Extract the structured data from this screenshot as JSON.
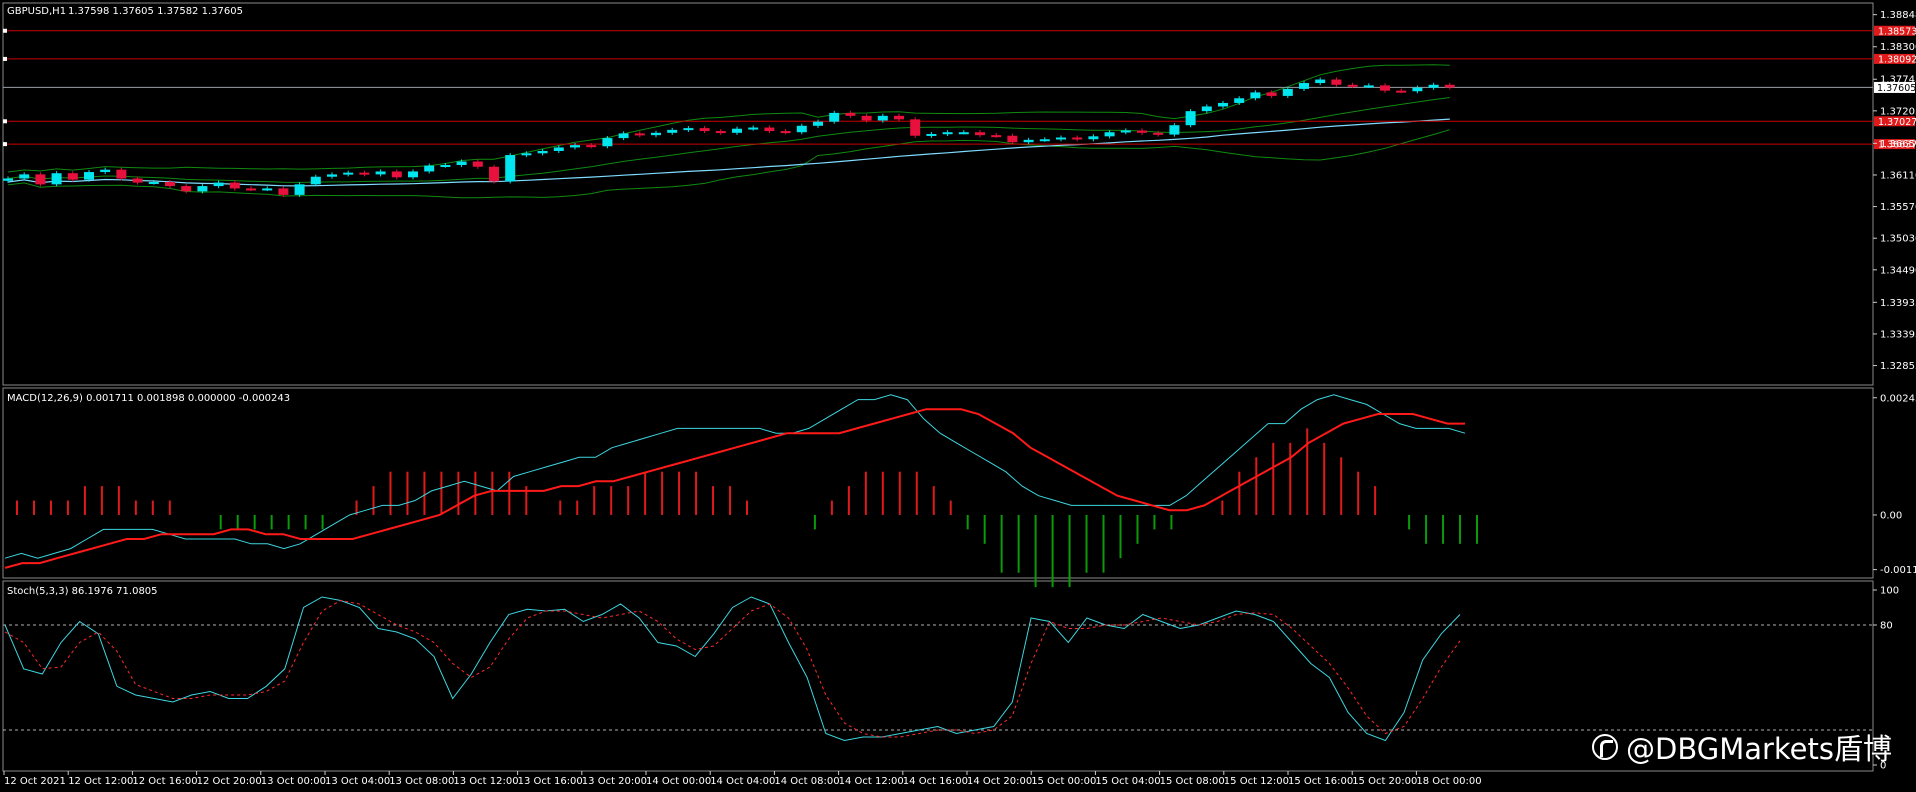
{
  "main_header": {
    "symbol": "GBPUSD,H1",
    "ohlc": "1.37598 1.37605 1.37582 1.37605"
  },
  "macd_header": "MACD(12,26,9) 0.001711 0.001898 0.000000 -0.000243",
  "stoch_header": "Stoch(5,3,3) 86.1976 71.0805",
  "watermark": "@DBGMarkets盾博",
  "colors": {
    "bull": "#00e5ee",
    "bear": "#e8103c",
    "bands": "#0f8a0f",
    "ma": "#7fdcff",
    "hline": "#c80000",
    "macd_line": "#3dd6e0",
    "signal_line": "#ff1a1a",
    "hist_pos": "#e01a1a",
    "hist_neg": "#0a9a0a",
    "stoch_main": "#3dd6e0",
    "stoch_signal": "#ff2a2a"
  },
  "chart_data": [
    {
      "type": "candlestick",
      "title": "GBPUSD,H1",
      "ylim": [
        1.3254,
        1.3903
      ],
      "y_ticks": [
        "1.38848",
        "1.38300",
        "1.37745",
        "1.37205",
        "1.36650",
        "1.36110",
        "1.35570",
        "1.35030",
        "1.34490",
        "1.33935",
        "1.33395",
        "1.32855"
      ],
      "y_tick_values": [
        1.38848,
        1.383,
        1.37745,
        1.37205,
        1.3665,
        1.3611,
        1.3557,
        1.3503,
        1.3449,
        1.33935,
        1.33395,
        1.32855
      ],
      "current_price": {
        "label": "1.37605",
        "value": 1.37605
      },
      "horizontal_levels": [
        {
          "label": "1.38573",
          "value": 1.38573
        },
        {
          "label": "1.38092",
          "value": 1.38092
        },
        {
          "label": "1.37027",
          "value": 1.37027
        },
        {
          "label": "1.36637",
          "value": 1.36637
        }
      ],
      "x_labels": [
        "12 Oct 2021",
        "12 Oct 12:00",
        "12 Oct 16:00",
        "12 Oct 20:00",
        "13 Oct 00:00",
        "13 Oct 04:00",
        "13 Oct 08:00",
        "13 Oct 12:00",
        "13 Oct 16:00",
        "13 Oct 20:00",
        "14 Oct 00:00",
        "14 Oct 04:00",
        "14 Oct 08:00",
        "14 Oct 12:00",
        "14 Oct 16:00",
        "14 Oct 20:00",
        "15 Oct 00:00",
        "15 Oct 04:00",
        "15 Oct 08:00",
        "15 Oct 12:00",
        "15 Oct 16:00",
        "15 Oct 20:00",
        "18 Oct 00:00"
      ],
      "closes": [
        1.3605,
        1.3612,
        1.3595,
        1.3614,
        1.3603,
        1.3616,
        1.362,
        1.3605,
        1.3598,
        1.3599,
        1.3592,
        1.3583,
        1.3592,
        1.3598,
        1.3588,
        1.3587,
        1.3588,
        1.3577,
        1.3595,
        1.3608,
        1.3612,
        1.3615,
        1.3612,
        1.3617,
        1.3607,
        1.3617,
        1.3627,
        1.3628,
        1.3634,
        1.3625,
        1.36,
        1.3645,
        1.3648,
        1.3652,
        1.3658,
        1.3662,
        1.366,
        1.3674,
        1.3682,
        1.3679,
        1.3683,
        1.3688,
        1.3691,
        1.3686,
        1.3683,
        1.369,
        1.3692,
        1.3686,
        1.3684,
        1.3695,
        1.3702,
        1.3717,
        1.3712,
        1.3704,
        1.3712,
        1.3706,
        1.3678,
        1.3681,
        1.3684,
        1.3684,
        1.3679,
        1.3678,
        1.3667,
        1.3671,
        1.3672,
        1.3675,
        1.3672,
        1.3677,
        1.3684,
        1.3687,
        1.3683,
        1.368,
        1.3696,
        1.372,
        1.3728,
        1.3734,
        1.3742,
        1.3752,
        1.3746,
        1.3758,
        1.3768,
        1.3774,
        1.3765,
        1.3763,
        1.3764,
        1.3755,
        1.3754,
        1.376,
        1.3765,
        1.37605
      ]
    },
    {
      "type": "line",
      "title": "MACD(12,26,9)",
      "y_ticks": [
        "0.002438",
        "0.00",
        "-0.001136"
      ],
      "ylim": [
        -0.00129,
        0.00262
      ],
      "main": 0.001711,
      "signal": 0.001898,
      "histogram_note": "OsMA bars: positive red, negative green",
      "macd_values": [
        -0.0009,
        -0.0008,
        -0.0009,
        -0.0008,
        -0.0007,
        -0.0005,
        -0.0003,
        -0.0003,
        -0.0003,
        -0.0003,
        -0.0004,
        -0.0005,
        -0.0005,
        -0.0005,
        -0.0005,
        -0.0006,
        -0.0006,
        -0.0007,
        -0.0006,
        -0.0004,
        -0.0002,
        0.0,
        0.0001,
        0.0002,
        0.0002,
        0.0003,
        0.0005,
        0.0006,
        0.0007,
        0.0006,
        0.0005,
        0.0008,
        0.0009,
        0.001,
        0.0011,
        0.0012,
        0.0012,
        0.0014,
        0.0015,
        0.0016,
        0.0017,
        0.0018,
        0.0018,
        0.0018,
        0.0018,
        0.0018,
        0.0018,
        0.0017,
        0.0017,
        0.0018,
        0.002,
        0.0022,
        0.0024,
        0.0024,
        0.0025,
        0.0024,
        0.002,
        0.0017,
        0.0015,
        0.0013,
        0.0011,
        0.0009,
        0.0006,
        0.0004,
        0.0003,
        0.0002,
        0.0002,
        0.0002,
        0.0002,
        0.0002,
        0.0002,
        0.0002,
        0.0004,
        0.0007,
        0.001,
        0.0013,
        0.0016,
        0.0019,
        0.0019,
        0.0022,
        0.0024,
        0.0025,
        0.0024,
        0.0023,
        0.0021,
        0.0019,
        0.0018,
        0.0018,
        0.0018,
        0.0017
      ],
      "signal_values": [
        -0.0011,
        -0.001,
        -0.001,
        -0.0009,
        -0.0008,
        -0.0007,
        -0.0006,
        -0.0005,
        -0.0005,
        -0.0004,
        -0.0004,
        -0.0004,
        -0.0004,
        -0.0003,
        -0.0003,
        -0.0004,
        -0.0004,
        -0.0005,
        -0.0005,
        -0.0005,
        -0.0005,
        -0.0004,
        -0.0003,
        -0.0002,
        -0.0001,
        0.0,
        0.0002,
        0.0004,
        0.0005,
        0.0005,
        0.0005,
        0.0005,
        0.0006,
        0.0006,
        0.0007,
        0.0007,
        0.0008,
        0.0009,
        0.001,
        0.0011,
        0.0012,
        0.0013,
        0.0014,
        0.0015,
        0.0016,
        0.0017,
        0.0017,
        0.0017,
        0.0017,
        0.0018,
        0.0019,
        0.002,
        0.0021,
        0.0022,
        0.0022,
        0.0022,
        0.0021,
        0.0019,
        0.0017,
        0.0014,
        0.0012,
        0.001,
        0.0008,
        0.0006,
        0.0004,
        0.0003,
        0.0002,
        0.0001,
        0.0001,
        0.0002,
        0.0004,
        0.0006,
        0.0008,
        0.001,
        0.0012,
        0.0015,
        0.0017,
        0.0019,
        0.002,
        0.0021,
        0.0021,
        0.0021,
        0.002,
        0.0019,
        0.0019
      ],
      "histogram": [
        0.0001,
        0.0001,
        0.0001,
        0.0001,
        0.0002,
        0.0002,
        0.0002,
        0.0001,
        0.0001,
        0.0001,
        0.0,
        0.0,
        -0.0001,
        -0.0001,
        -0.0001,
        -0.0001,
        -0.0001,
        -0.0001,
        -0.0001,
        0.0,
        0.0001,
        0.0002,
        0.0003,
        0.0003,
        0.0003,
        0.0003,
        0.0003,
        0.0003,
        0.0003,
        0.0003,
        0.0002,
        0.0,
        0.0001,
        0.0001,
        0.0002,
        0.0002,
        0.0002,
        0.0003,
        0.0003,
        0.0003,
        0.0003,
        0.0002,
        0.0002,
        0.0001,
        0.0,
        0.0,
        0.0,
        -0.0001,
        0.0001,
        0.0002,
        0.0003,
        0.0003,
        0.0003,
        0.0003,
        0.0002,
        0.0001,
        -0.0001,
        -0.0002,
        -0.0004,
        -0.0004,
        -0.0005,
        -0.0005,
        -0.0005,
        -0.0004,
        -0.0004,
        -0.0003,
        -0.0002,
        -0.0001,
        -0.0001,
        0.0,
        0.0,
        0.0001,
        0.0003,
        0.0004,
        0.0005,
        0.0005,
        0.0006,
        0.0005,
        0.0004,
        0.0003,
        0.0002,
        0.0,
        -0.0001,
        -0.0002,
        -0.0002,
        -0.0002,
        -0.0002
      ]
    },
    {
      "type": "line",
      "title": "Stoch(5,3,3)",
      "y_ticks": [
        "100",
        "80",
        "0"
      ],
      "ylim": [
        0,
        100
      ],
      "levels": [
        80,
        20
      ],
      "main": 86.1976,
      "signal": 71.0805,
      "main_values": [
        80,
        55,
        52,
        70,
        82,
        75,
        45,
        40,
        38,
        36,
        40,
        42,
        38,
        38,
        45,
        55,
        90,
        96,
        94,
        90,
        78,
        76,
        72,
        62,
        38,
        52,
        70,
        86,
        89,
        88,
        89,
        82,
        86,
        92,
        84,
        70,
        68,
        62,
        75,
        90,
        96,
        92,
        70,
        50,
        18,
        14,
        16,
        16,
        18,
        20,
        22,
        18,
        20,
        22,
        36,
        84,
        82,
        70,
        84,
        80,
        78,
        86,
        82,
        78,
        80,
        84,
        88,
        86,
        82,
        70,
        58,
        50,
        30,
        18,
        14,
        30,
        60,
        75,
        86
      ],
      "signal_values": [
        76,
        70,
        55,
        56,
        70,
        76,
        65,
        46,
        42,
        38,
        38,
        40,
        40,
        40,
        42,
        48,
        70,
        88,
        94,
        92,
        86,
        80,
        76,
        70,
        58,
        50,
        56,
        72,
        84,
        88,
        88,
        86,
        84,
        86,
        88,
        82,
        72,
        66,
        68,
        78,
        88,
        92,
        84,
        66,
        40,
        24,
        18,
        16,
        16,
        18,
        20,
        20,
        18,
        20,
        28,
        58,
        82,
        78,
        78,
        80,
        80,
        82,
        84,
        82,
        80,
        82,
        86,
        87,
        86,
        78,
        68,
        58,
        44,
        28,
        18,
        22,
        38,
        56,
        71
      ]
    }
  ]
}
